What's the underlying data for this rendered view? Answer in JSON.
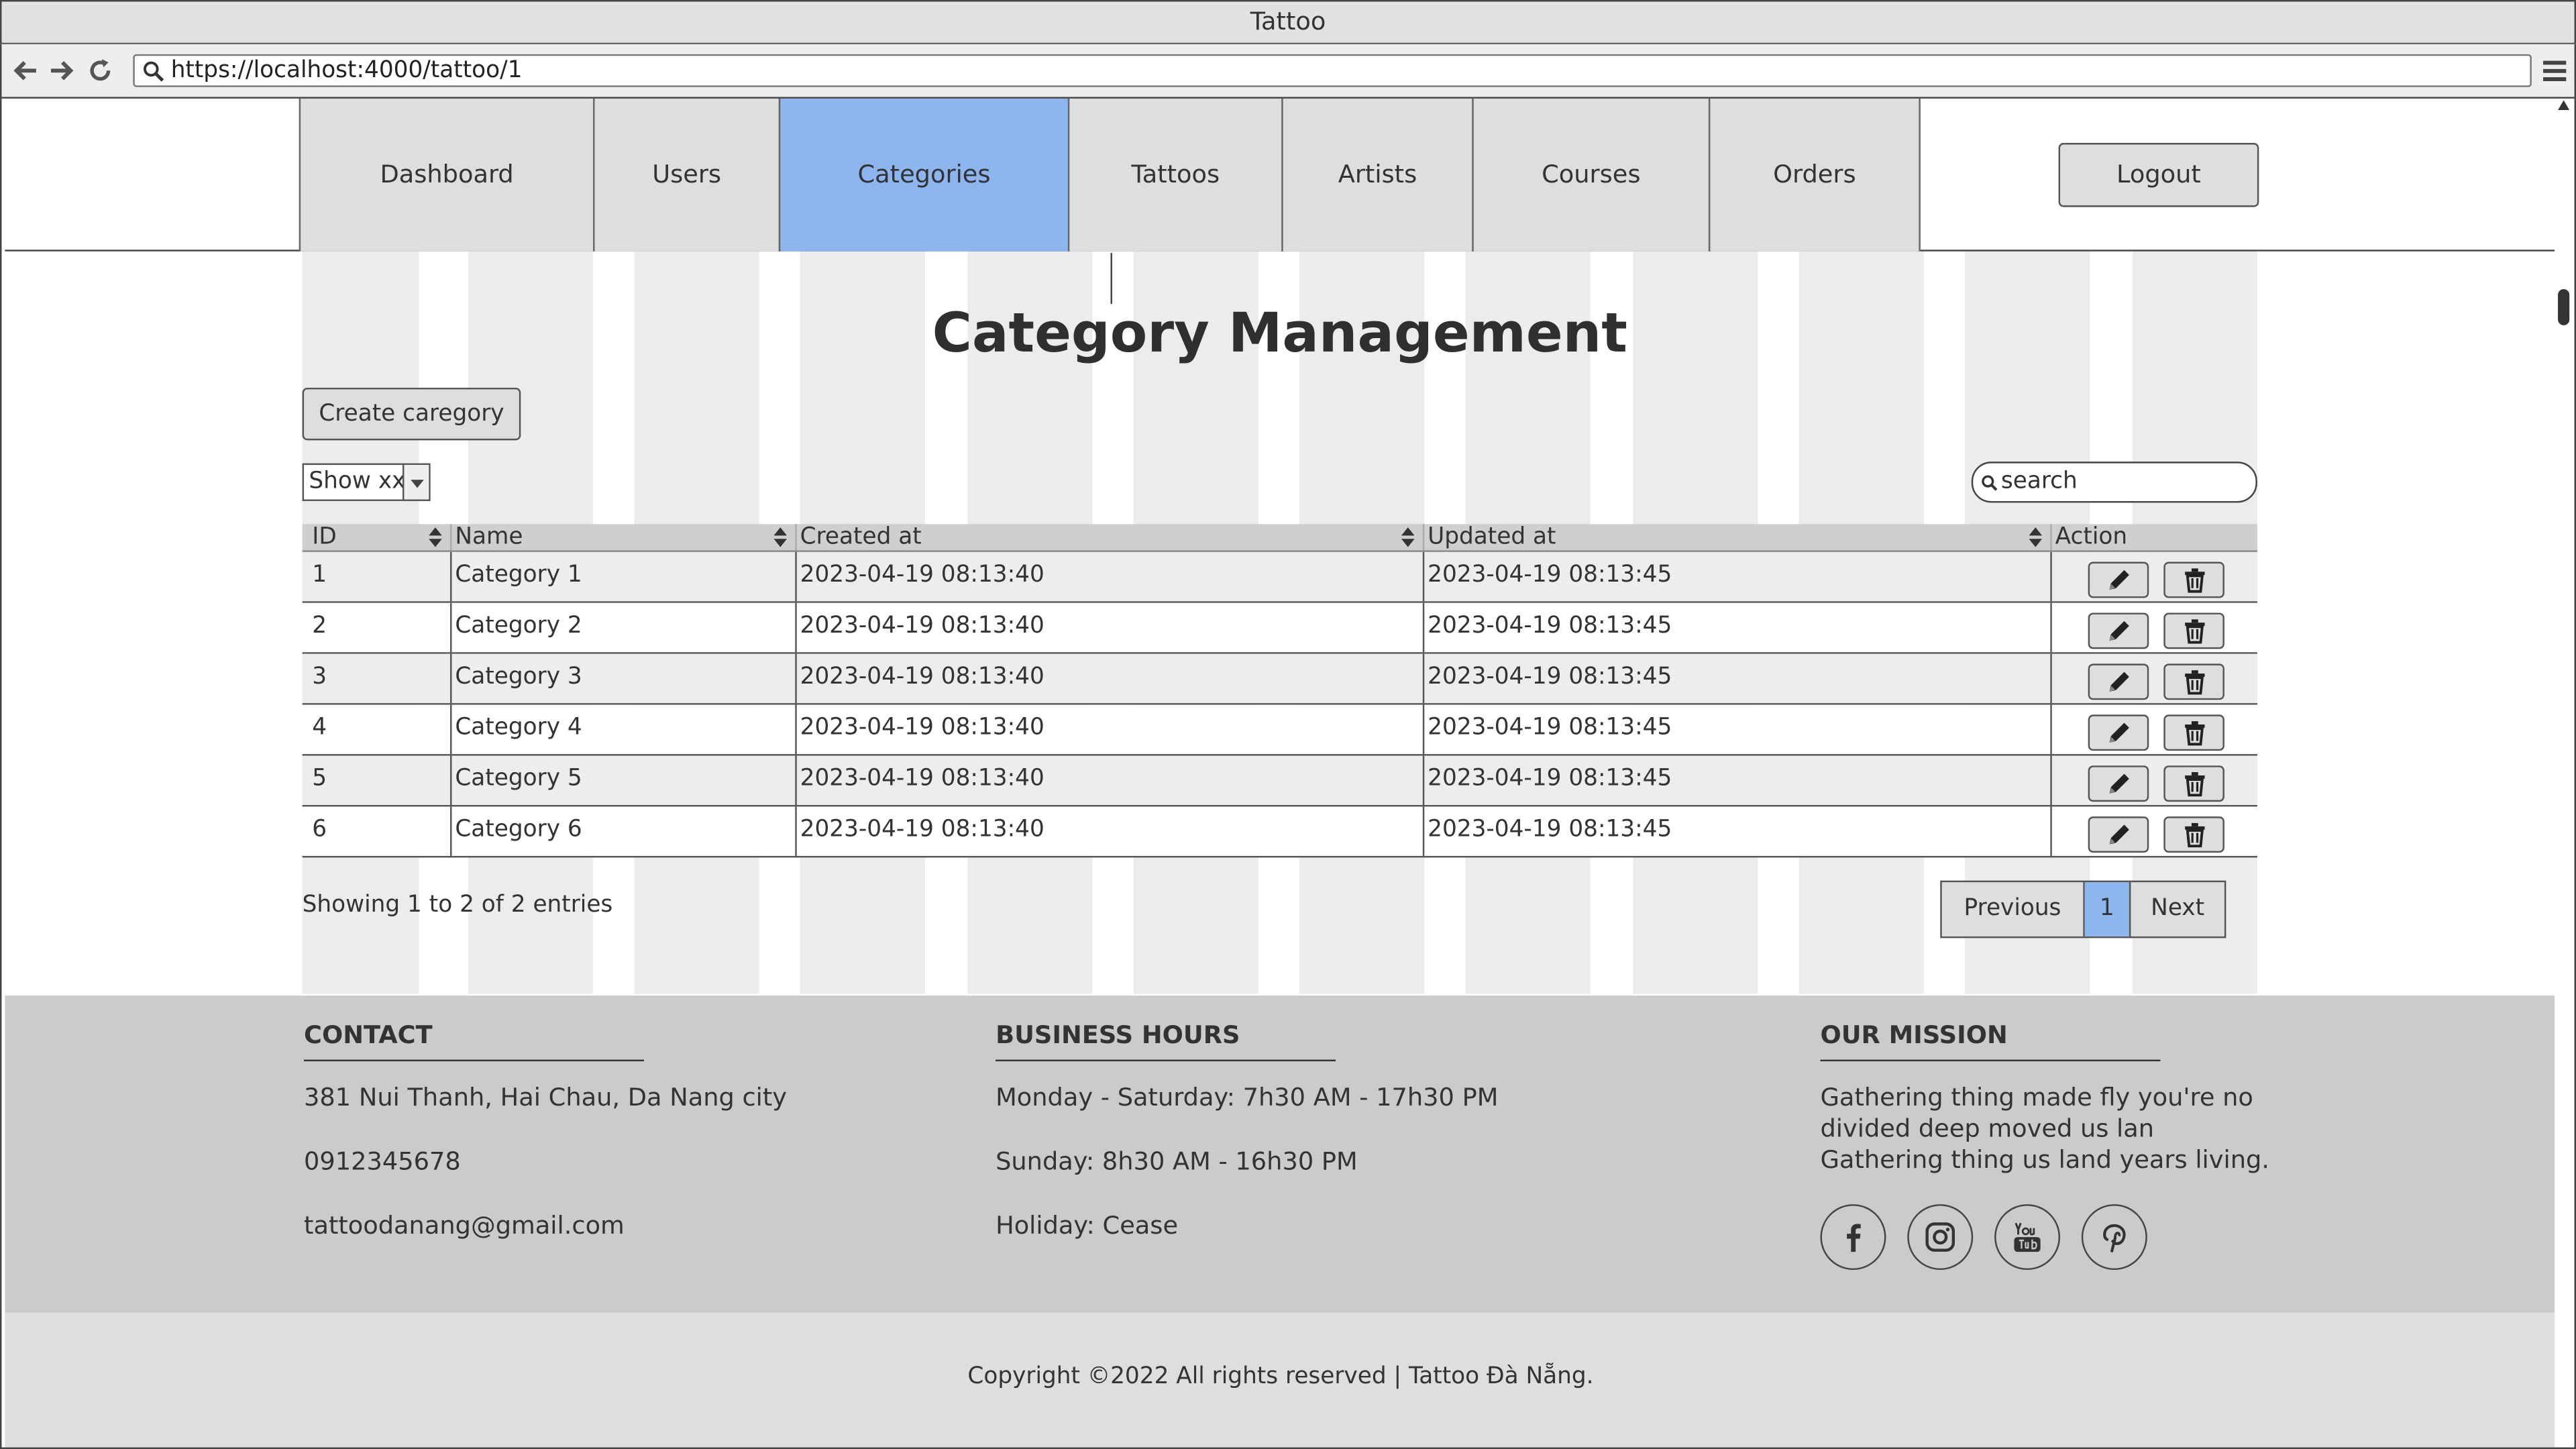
{
  "window": {
    "title": "Tattoo"
  },
  "browser": {
    "url": "https://localhost:4000/tattoo/1"
  },
  "nav": {
    "tabs": [
      {
        "label": "Dashboard"
      },
      {
        "label": "Users"
      },
      {
        "label": "Categories"
      },
      {
        "label": "Tattoos"
      },
      {
        "label": "Artists"
      },
      {
        "label": "Courses"
      },
      {
        "label": "Orders"
      }
    ],
    "active_tab": "Categories",
    "logout_label": "Logout"
  },
  "page": {
    "title": "Category Management",
    "create_label": "Create caregory",
    "show_select": "Show xx",
    "search_placeholder": "search"
  },
  "table": {
    "headers": [
      "ID",
      "Name",
      "Created at",
      "Updated at",
      "Action"
    ],
    "rows": [
      {
        "id": "1",
        "name": "Category 1",
        "created": "2023-04-19 08:13:40",
        "updated": "2023-04-19 08:13:45"
      },
      {
        "id": "2",
        "name": "Category 2",
        "created": "2023-04-19 08:13:40",
        "updated": "2023-04-19 08:13:45"
      },
      {
        "id": "3",
        "name": "Category 3",
        "created": "2023-04-19 08:13:40",
        "updated": "2023-04-19 08:13:45"
      },
      {
        "id": "4",
        "name": "Category 4",
        "created": "2023-04-19 08:13:40",
        "updated": "2023-04-19 08:13:45"
      },
      {
        "id": "5",
        "name": "Category 5",
        "created": "2023-04-19 08:13:40",
        "updated": "2023-04-19 08:13:45"
      },
      {
        "id": "6",
        "name": "Category 6",
        "created": "2023-04-19 08:13:40",
        "updated": "2023-04-19 08:13:45"
      }
    ]
  },
  "pagination": {
    "summary": "Showing 1 to 2 of 2 entries",
    "previous": "Previous",
    "current": "1",
    "next": "Next"
  },
  "footer": {
    "contact": {
      "heading": "CONTACT",
      "address": "381 Nui Thanh, Hai Chau, Da Nang city",
      "phone": "0912345678",
      "email": "tattoodanang@gmail.com"
    },
    "hours": {
      "heading": "BUSINESS HOURS",
      "weekdays": "Monday - Saturday: 7h30 AM - 17h30 PM",
      "sunday": "Sunday: 8h30 AM - 16h30 PM",
      "holiday": "Holiday: Cease"
    },
    "mission": {
      "heading": "OUR MISSION",
      "lines": [
        "Gathering thing made fly you're no",
        "divided deep moved us lan",
        "Gathering thing us land years living."
      ],
      "social_icons": [
        "facebook-icon",
        "instagram-icon",
        "youtube-icon",
        "pinterest-icon"
      ]
    },
    "copyright": "Copyright ©2022 All rights reserved | Tattoo Đà Nẵng."
  },
  "colors": {
    "active_tab": "#8db6ef",
    "footer_bg": "#cbcbcb",
    "tab_bg": "#dedede"
  }
}
